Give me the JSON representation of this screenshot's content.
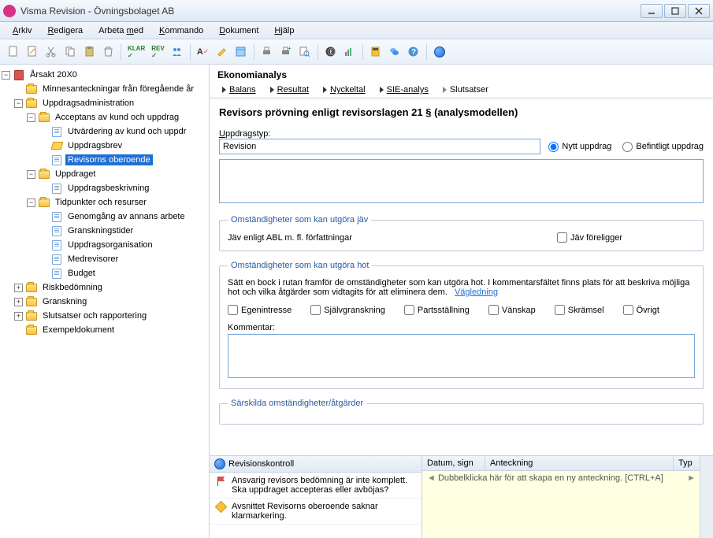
{
  "window": {
    "title": "Visma Revision - Övningsbolaget AB"
  },
  "menu": {
    "arkiv": "Arkiv",
    "redigera": "Redigera",
    "arbeta_med": "Arbeta med",
    "kommando": "Kommando",
    "dokument": "Dokument",
    "hjalp": "Hjälp"
  },
  "tree": {
    "root": "Årsakt 20X0",
    "minnes": "Minnesanteckningar från föregående år",
    "uppdragsadmin": "Uppdragsadministration",
    "acceptans": "Acceptans av kund och uppdrag",
    "utvardering": "Utvärdering av kund och uppdr",
    "uppdragsbrev": "Uppdragsbrev",
    "revisorns": "Revisorns oberoende",
    "uppdraget": "Uppdraget",
    "uppdragsbeskrivning": "Uppdragsbeskrivning",
    "tidpunkter": "Tidpunkter och resurser",
    "genomgang": "Genomgång av annans arbete",
    "granskningstider": "Granskningstider",
    "uppdragsorg": "Uppdragsorganisation",
    "medrevisorer": "Medrevisorer",
    "budget": "Budget",
    "riskbedomning": "Riskbedömning",
    "granskning": "Granskning",
    "slutsatser": "Slutsatser och rapportering",
    "exempel": "Exempeldokument"
  },
  "analysis": {
    "title": "Ekonomianalys",
    "tabs": {
      "balans": "Balans",
      "resultat": "Resultat",
      "nyckeltal": "Nyckeltal",
      "sie": "SIE-analys",
      "slutsatser": "Slutsatser"
    }
  },
  "form": {
    "title": "Revisors prövning enligt revisorslagen 21 § (analysmodellen)",
    "uppdragstyp_label": "Uppdragstyp:",
    "uppdragstyp_value": "Revision",
    "nytt_uppdrag": "Nytt uppdrag",
    "befintligt_uppdrag": "Befintligt uppdrag",
    "jav_legend": "Omständigheter som kan utgöra jäv",
    "jav_text": "Jäv enligt ABL m. fl. författningar",
    "jav_foreligger": "Jäv föreligger",
    "hot_legend": "Omständigheter som kan utgöra hot",
    "hot_text": "Sätt en bock i rutan framför de omständigheter som kan utgöra hot. I kommentarsfältet finns plats för att beskriva möjliga hot och vilka åtgärder som vidtagits för att eliminera dem.",
    "vagledning": "Vägledning",
    "checks": {
      "egen": "Egenintresse",
      "sjalv": "Självgranskning",
      "parts": "Partsställning",
      "vanskap": "Vänskap",
      "skramsel": "Skrämsel",
      "ovrigt": "Övrigt"
    },
    "kommentar_label": "Kommentar:",
    "sarskilda_legend": "Särskilda omständigheter/åtgärder"
  },
  "revision": {
    "title": "Revisionskontroll",
    "item1": "Ansvarig revisors bedömning är inte komplett. Ska uppdraget accepteras eller avböjas?",
    "item2": "Avsnittet Revisorns oberoende saknar klarmarkering."
  },
  "notes": {
    "col_datum": "Datum, sign",
    "col_anteckning": "Anteckning",
    "col_typ": "Typ",
    "placeholder": "Dubbelklicka här för att skapa en ny anteckning. [CTRL+A]"
  }
}
